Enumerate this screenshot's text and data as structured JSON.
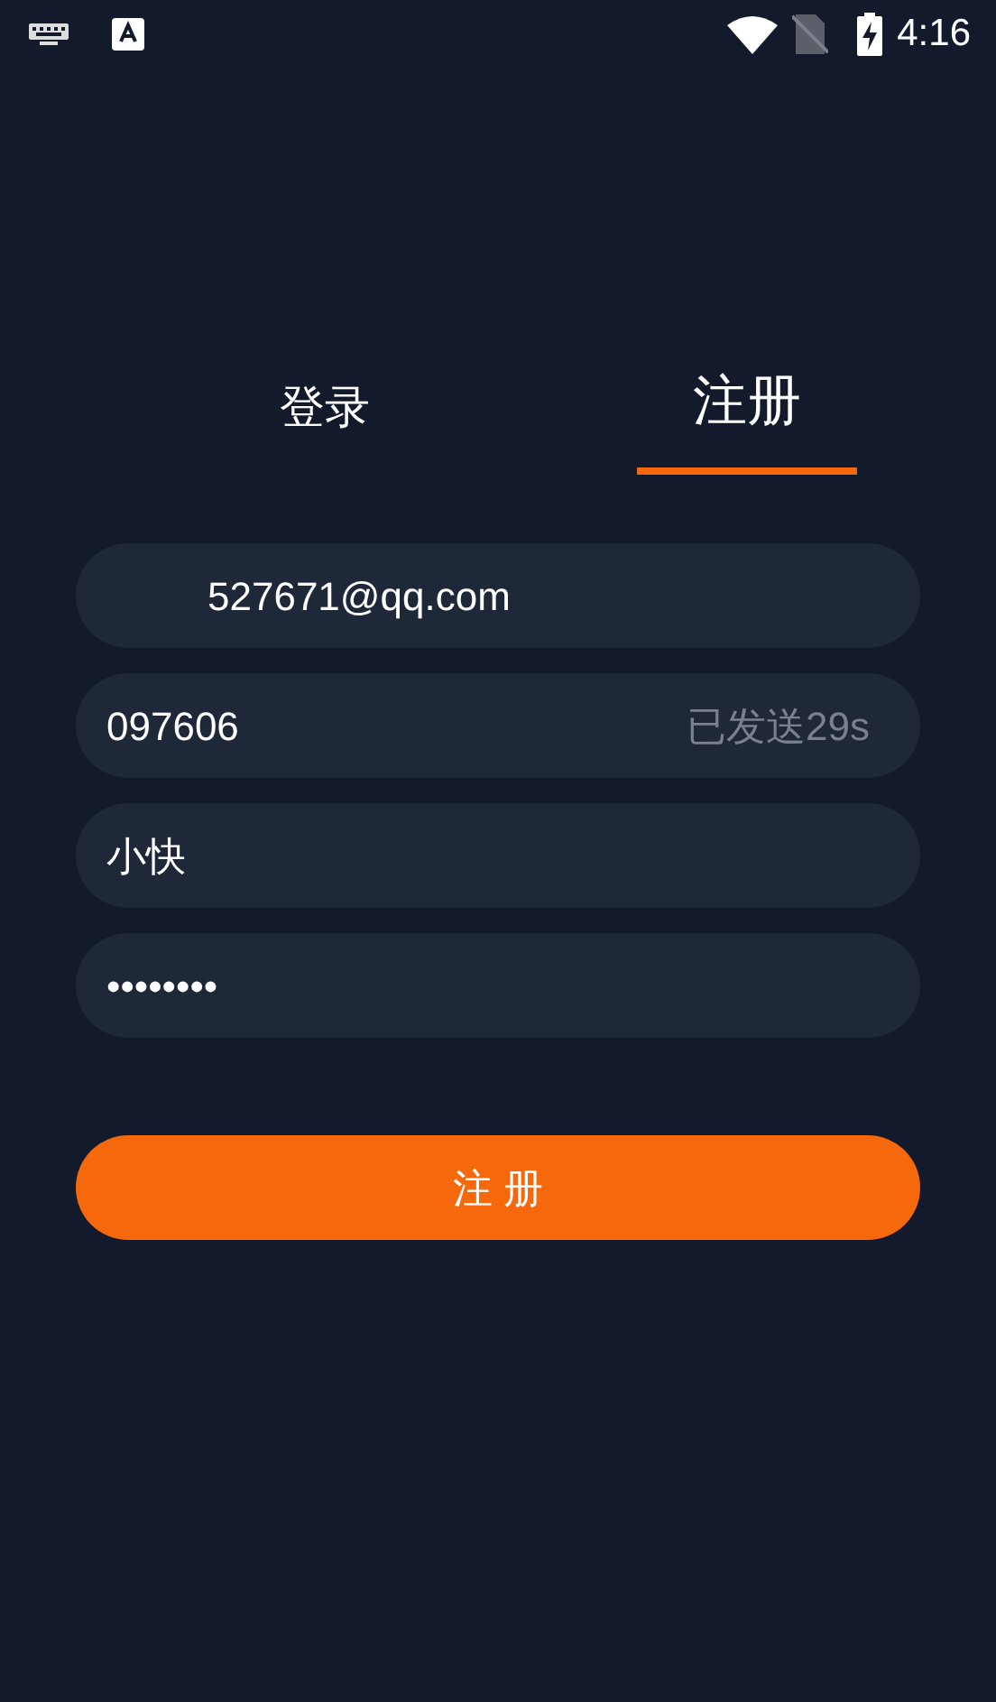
{
  "status_bar": {
    "time": "4:16"
  },
  "tabs": [
    {
      "label": "登录",
      "selected": false
    },
    {
      "label": "注册",
      "selected": true
    }
  ],
  "fields": [
    {
      "kind": "email",
      "value": "527671@qq.com"
    },
    {
      "kind": "code",
      "value": "097606",
      "suffix": "已发送29s"
    },
    {
      "kind": "text",
      "value": "小快"
    },
    {
      "kind": "password",
      "value": "••••••••"
    }
  ],
  "submit_button": "注 册"
}
